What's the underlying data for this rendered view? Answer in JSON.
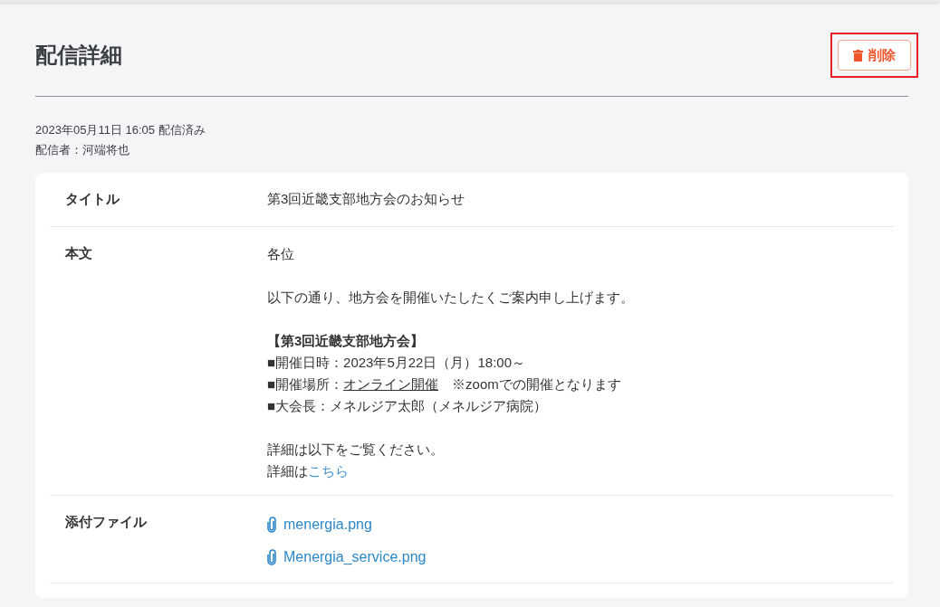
{
  "page_title": "配信詳細",
  "delete_button": {
    "label": "削除",
    "highlighted": true
  },
  "meta": [
    "2023年05月11日 16:05 配信済み",
    "配信者：河端将也"
  ],
  "rows": [
    {
      "label": "タイトル",
      "kind": "text",
      "value": "第3回近畿支部地方会のお知らせ"
    },
    {
      "label": "本文",
      "kind": "body",
      "paragraphs": [
        [
          [
            {
              "text": "各位",
              "kind": "plain"
            }
          ]
        ],
        [
          [
            {
              "text": "以下の通り、地方会を開催いたしたくご案内申し上げます。",
              "kind": "plain"
            }
          ]
        ],
        [
          [
            {
              "text": "【第3回近畿支部地方会】",
              "kind": "bold"
            }
          ],
          [
            {
              "text": "■開催日時：2023年5月22日（月）18:00～",
              "kind": "plain"
            }
          ],
          [
            {
              "text": "■開催場所：",
              "kind": "plain"
            },
            {
              "text": "オンライン開催",
              "kind": "underline"
            },
            {
              "text": "　※zoomでの開催となります",
              "kind": "plain"
            }
          ],
          [
            {
              "text": "■大会長：メネルジア太郎（メネルジア病院）",
              "kind": "plain"
            }
          ]
        ],
        [
          [
            {
              "text": "詳細は以下をご覧ください。",
              "kind": "plain"
            }
          ],
          [
            {
              "text": "詳細は",
              "kind": "plain"
            },
            {
              "text": "こちら",
              "kind": "link"
            }
          ]
        ]
      ]
    },
    {
      "label": "添付ファイル",
      "kind": "files",
      "files": [
        "menergia.png",
        "Menergia_service.png"
      ]
    }
  ]
}
